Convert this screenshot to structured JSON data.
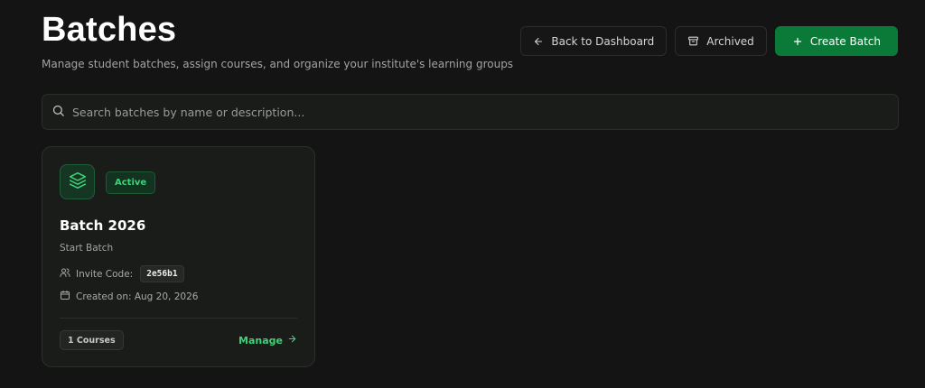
{
  "header": {
    "title": "Batches",
    "subtitle": "Manage student batches, assign courses, and organize your institute's learning groups"
  },
  "actions": {
    "back_label": "Back to Dashboard",
    "archived_label": "Archived",
    "create_label": "Create Batch"
  },
  "search": {
    "placeholder": "Search batches by name or description...",
    "value": ""
  },
  "batches": [
    {
      "status": "Active",
      "name": "Batch 2026",
      "description": "Start Batch",
      "invite_label": "Invite Code:",
      "invite_code": "2e56b1",
      "created_text": "Created on: Aug 20, 2026",
      "courses_text": "1 Courses",
      "manage_label": "Manage"
    }
  ],
  "icons": {
    "back": "arrow-left-icon",
    "archived": "archive-icon",
    "create": "plus-icon",
    "search": "search-icon",
    "batch": "layers-icon",
    "invite": "users-icon",
    "created": "calendar-icon",
    "manage": "arrow-right-icon"
  },
  "colors": {
    "background": "#141414",
    "accent": "#0b7a39",
    "accent_text": "#3fd17a"
  }
}
